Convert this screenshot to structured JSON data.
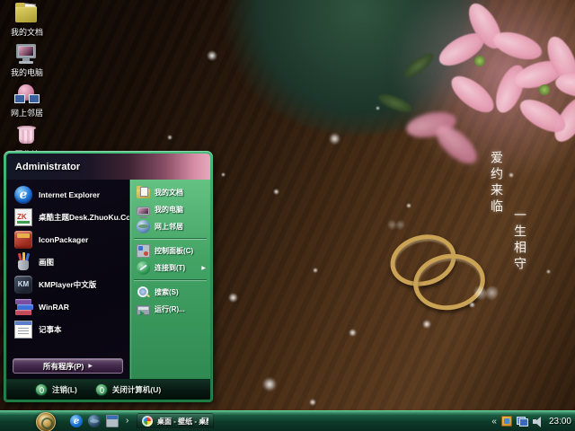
{
  "desktop": {
    "icons": [
      {
        "label": "我的文档"
      },
      {
        "label": "我的电脑"
      },
      {
        "label": "网上邻居"
      },
      {
        "label": "回收站"
      }
    ],
    "wallpaper_text": {
      "line1": "爱约来临",
      "line2": "一生相守"
    }
  },
  "start_menu": {
    "user": "Administrator",
    "programs": [
      {
        "label": "Internet Explorer"
      },
      {
        "label": "桌酷主题Desk.ZhuoKu.Com"
      },
      {
        "label": "IconPackager"
      },
      {
        "label": "画图"
      },
      {
        "label": "KMPlayer中文版"
      },
      {
        "label": "WinRAR"
      },
      {
        "label": "记事本"
      }
    ],
    "all_programs": "所有程序(P)",
    "places": [
      "我的文档",
      "我的电脑",
      "网上邻居"
    ],
    "system_items": [
      "控制面板(C)",
      "连接到(T)"
    ],
    "tools": [
      "搜索(S)",
      "运行(R)..."
    ],
    "logoff": "注销(L)",
    "shutdown": "关闭计算机(U)"
  },
  "taskbar": {
    "task_button": "桌面 - 壁纸 - 桌酷...",
    "tray_time": "23:00"
  },
  "glyphs": {
    "submenu_arrow": "▶",
    "all_programs_arrow": "▶",
    "quicklaunch_more": "›",
    "tray_collapse": "«",
    "ie_letter": "e",
    "kmplayer_letters": "KM"
  },
  "colors": {
    "menu_green": "#2a9c5c",
    "taskbar_green": "#0d3a2a",
    "accent_gold": "#c9a255",
    "flower_pink": "#eba6bb"
  }
}
